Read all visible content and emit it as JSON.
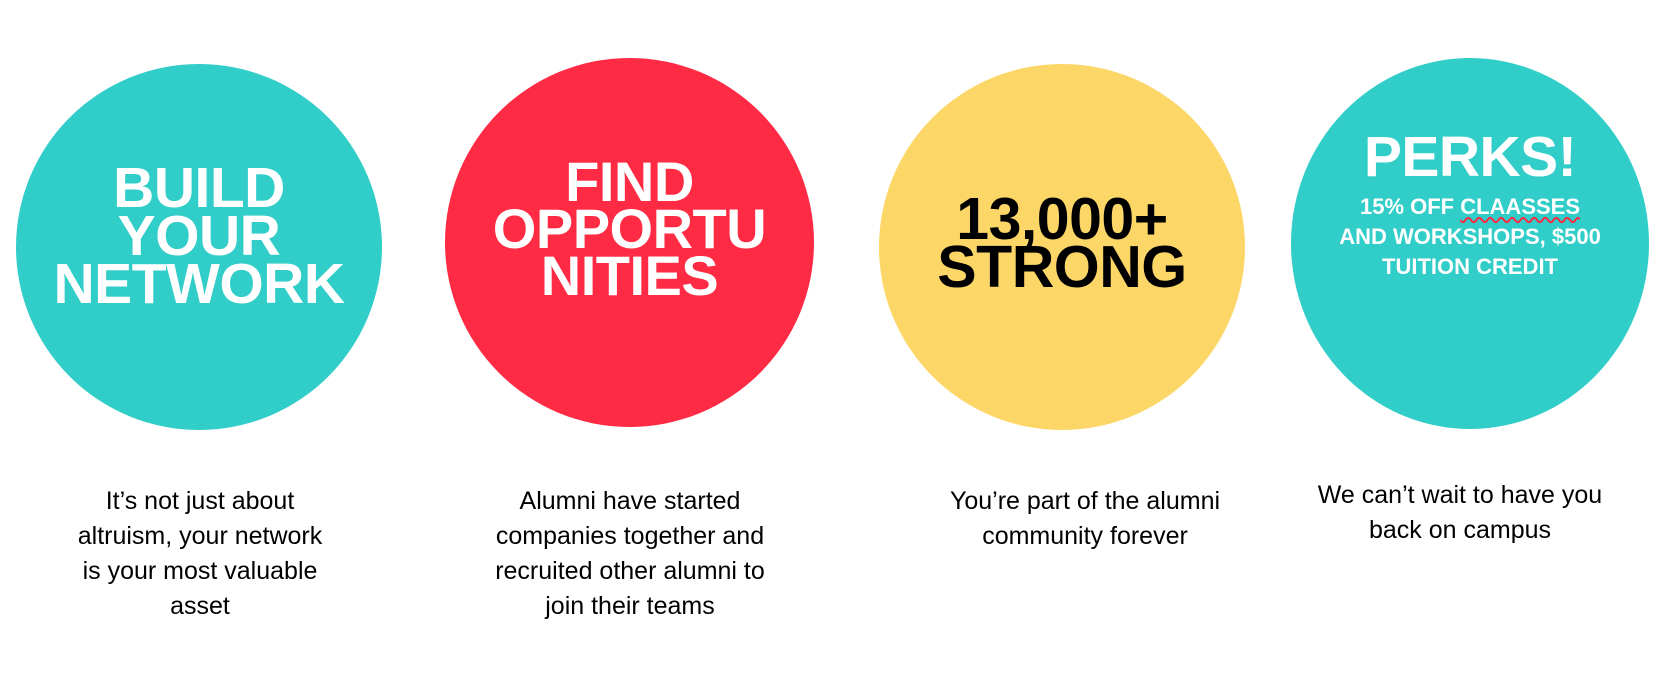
{
  "colors": {
    "teal": "#31cdc8",
    "red": "#ff2a43",
    "yellow": "#fcd667",
    "white": "#ffffff",
    "black": "#000000"
  },
  "cards": [
    {
      "headline_lines": [
        "BUILD",
        "YOUR",
        "NETWORK"
      ],
      "caption_lines": [
        "It’s not just about",
        "altruism, your network",
        "is your most valuable",
        "asset"
      ]
    },
    {
      "headline_lines": [
        "FIND",
        "OPPORTU",
        "NITIES"
      ],
      "caption_lines": [
        "Alumni have started",
        "companies together and",
        "recruited other alumni to",
        "join their teams"
      ]
    },
    {
      "headline_lines": [
        "13,000+",
        "STRONG"
      ],
      "caption_lines": [
        "You’re part of the alumni",
        "community forever"
      ]
    },
    {
      "headline_lines": [
        "PERKS!"
      ],
      "subline_parts": {
        "line1_prefix": "15% OFF ",
        "line1_flagged": "CLAASSES",
        "line2": "AND WORKSHOPS, $500",
        "line3": "TUITION CREDIT"
      },
      "caption_lines": [
        "We can’t wait to have you",
        "back on campus"
      ]
    }
  ]
}
